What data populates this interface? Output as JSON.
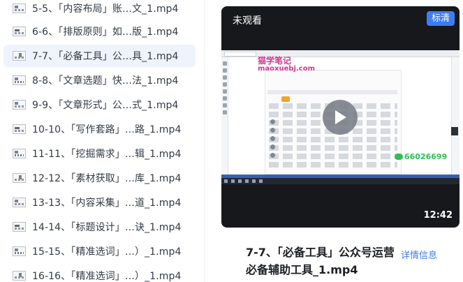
{
  "file_list": {
    "items": [
      {
        "label": "5-5、「内容布局」账…文_1.mp4",
        "selected": false
      },
      {
        "label": "6-6、「排版原则」如…版_1.mp4",
        "selected": false
      },
      {
        "label": "7-7、「必备工具」公…具_1.mp4",
        "selected": true
      },
      {
        "label": "8-8、「文章选题」快…法_1.mp4",
        "selected": false
      },
      {
        "label": "9-9、「文章形式」公…式_1.mp4",
        "selected": false
      },
      {
        "label": "10-10、「写作套路」…路_1.mp4",
        "selected": false
      },
      {
        "label": "11-11、「挖掘需求」…辑_1.mp4",
        "selected": false
      },
      {
        "label": "12-12、「素材获取」…库_1.mp4",
        "selected": false
      },
      {
        "label": "13-13、「内容采集」…道_1.mp4",
        "selected": false
      },
      {
        "label": "14-14、「标题设计」…诀_1.mp4",
        "selected": false
      },
      {
        "label": "15-15、「精准选词」…）_1.mp4",
        "selected": false
      },
      {
        "label": "16-16、「精准选词」…）_1.mp4",
        "selected": false
      }
    ]
  },
  "video": {
    "watch_status": "未观看",
    "tag": "标清",
    "duration": "12:42",
    "watermark_line1": "猫学笔记",
    "watermark_line2": "maoxuebj.com",
    "contact_number": "66026699"
  },
  "info": {
    "title": "7-7、「必备工具」公众号运营必备辅助工具_1.mp4",
    "detail_link": "详情信息"
  },
  "colors": {
    "accent": "#3d7cf5",
    "selected_row_bg": "#eef3fe",
    "video_bg": "#17181b"
  },
  "icons": {
    "file_thumb": "video-thumbnail-icon",
    "play": "play-icon"
  }
}
